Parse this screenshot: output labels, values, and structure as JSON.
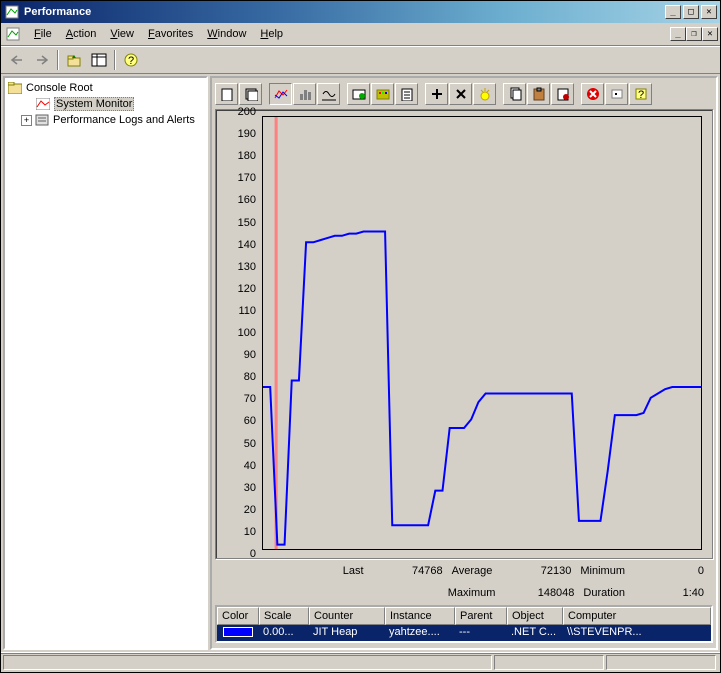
{
  "window": {
    "title": "Performance"
  },
  "menu": {
    "file": "File",
    "action": "Action",
    "view": "View",
    "favorites": "Favorites",
    "window": "Window",
    "help": "Help"
  },
  "tree": {
    "root": "Console Root",
    "sysmon": "System Monitor",
    "perflogs": "Performance Logs and Alerts"
  },
  "chart_data": {
    "type": "line",
    "ylim": [
      0,
      200
    ],
    "yticks": [
      0,
      10,
      20,
      30,
      40,
      50,
      60,
      70,
      80,
      90,
      100,
      110,
      120,
      130,
      140,
      150,
      160,
      170,
      180,
      190,
      200
    ],
    "duration_seconds": 100,
    "series": [
      {
        "name": "JIT Heap",
        "color": "#0000ff",
        "values": [
          75,
          75,
          2,
          2,
          78,
          78,
          142,
          142,
          143,
          144,
          145,
          145,
          146,
          146,
          147,
          147,
          147,
          147,
          11,
          11,
          11,
          11,
          11,
          11,
          27,
          27,
          56,
          56,
          56,
          60,
          68,
          72,
          72,
          72,
          72,
          72,
          72,
          72,
          72,
          72,
          72,
          72,
          72,
          72,
          13,
          13,
          13,
          13,
          36,
          62,
          62,
          62,
          62,
          63,
          70,
          72,
          74,
          75,
          75,
          75,
          75,
          75
        ]
      }
    ],
    "cursor_x_percent": 3
  },
  "stats": {
    "last_label": "Last",
    "last_val": "74768",
    "avg_label": "Average",
    "avg_val": "72130",
    "min_label": "Minimum",
    "min_val": "0",
    "max_label": "Maximum",
    "max_val": "148048",
    "dur_label": "Duration",
    "dur_val": "1:40"
  },
  "columns": {
    "color": "Color",
    "scale": "Scale",
    "counter": "Counter",
    "instance": "Instance",
    "parent": "Parent",
    "object": "Object",
    "computer": "Computer"
  },
  "row": {
    "scale": "0.00...",
    "counter": "JIT Heap",
    "instance": "yahtzee....",
    "parent": "---",
    "object": ".NET C...",
    "computer": "\\\\STEVENPR..."
  }
}
